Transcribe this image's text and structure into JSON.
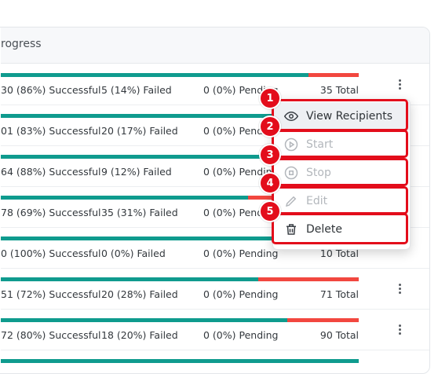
{
  "header": {
    "label": "rogress"
  },
  "rows": [
    {
      "success": "30 (86%) Successful",
      "failed": "5 (14%) Failed",
      "pending": "0 (0%) Pending",
      "total": "35 Total",
      "ok_pct": 0.86
    },
    {
      "success": "01 (83%) Successful",
      "failed": "20 (17%) Failed",
      "pending": "0 (0%) Pending",
      "total": "",
      "ok_pct": 0.83
    },
    {
      "success": "64 (88%) Successful",
      "failed": "9 (12%) Failed",
      "pending": "0 (0%) Pending",
      "total": "",
      "ok_pct": 0.88
    },
    {
      "success": "78 (69%) Successful",
      "failed": "35 (31%) Failed",
      "pending": "0 (0%) Pending",
      "total": "",
      "ok_pct": 0.69
    },
    {
      "success": "0 (100%) Successful",
      "failed": "0 (0%) Failed",
      "pending": "0 (0%) Pending",
      "total": "10 Total",
      "ok_pct": 1.0
    },
    {
      "success": "51 (72%) Successful",
      "failed": "20 (28%) Failed",
      "pending": "0 (0%) Pending",
      "total": "71 Total",
      "ok_pct": 0.72
    },
    {
      "success": "72 (80%) Successful",
      "failed": "18 (20%) Failed",
      "pending": "0 (0%) Pending",
      "total": "90 Total",
      "ok_pct": 0.8
    }
  ],
  "menu": {
    "items": [
      {
        "label": "View Recipients",
        "icon": "eye-icon",
        "state": "active"
      },
      {
        "label": "Start",
        "icon": "play-circle-icon",
        "state": "disabled"
      },
      {
        "label": "Stop",
        "icon": "stop-circle-icon",
        "state": "disabled"
      },
      {
        "label": "Edit",
        "icon": "pencil-icon",
        "state": "disabled"
      },
      {
        "label": "Delete",
        "icon": "trash-icon",
        "state": "normal"
      }
    ]
  },
  "badges": [
    "1",
    "2",
    "3",
    "4",
    "5"
  ],
  "colors": {
    "success": "#0f9b8e",
    "failed": "#f2473f",
    "highlight": "#e30d1b"
  }
}
